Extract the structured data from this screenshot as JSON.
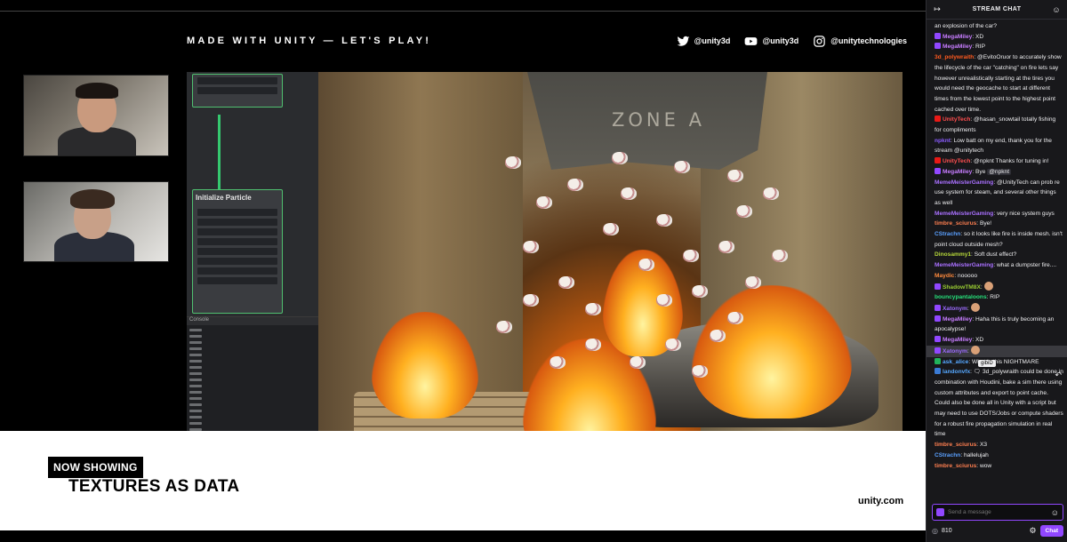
{
  "stream": {
    "header": "MADE WITH UNITY —  LET'S PLAY!",
    "socials": [
      {
        "icon": "twitter-icon",
        "handle": "@unity3d"
      },
      {
        "icon": "youtube-icon",
        "handle": "@unity3d"
      },
      {
        "icon": "instagram-icon",
        "handle": "@unitytechnologies"
      }
    ],
    "vfx_node_title": "Initialize Particle",
    "scene_sign": "ZONE A",
    "now_showing": "NOW SHOWING",
    "title": "TEXTURES AS DATA",
    "url": "unity.com"
  },
  "chat": {
    "header": "STREAM CHAT",
    "collapse_icon": "collapse-arrow-icon",
    "users_icon": "community-icon",
    "messages": [
      {
        "user": "",
        "color": "#efeff1",
        "text": "an explosion of the car?"
      },
      {
        "user": "MegaMiley",
        "color": "#c77dff",
        "badge": "#9147ff",
        "text": ": XD"
      },
      {
        "user": "MegaMiley",
        "color": "#c77dff",
        "badge": "#9147ff",
        "text": ": RIP"
      },
      {
        "user": "3d_polywraith",
        "color": "#ff5a1f",
        "text": ": @EvitoOruor to accurately show the lifecycle of the car \"catching\" on fire lets say however unrealistically starting at the tires you would need the geocache to start at different times from the lowest point to the highest point cached over time."
      },
      {
        "user": "UnityTech",
        "color": "#ff4f4f",
        "badge": "#e91916",
        "text": ": @hasan_snowtail totally fishing for compliments"
      },
      {
        "user": "npknt",
        "color": "#8a5cff",
        "text": ": Low batt on my end, thank you for the stream @unitytech"
      },
      {
        "user": "UnityTech",
        "color": "#ff4f4f",
        "badge": "#e91916",
        "text": ": @npknt  Thanks for tuning in!"
      },
      {
        "user": "MegaMiley",
        "color": "#c77dff",
        "badge": "#9147ff",
        "text": ": Bye ",
        "mention": "@npknt"
      },
      {
        "user": "MemeMeisterGaming",
        "color": "#a970ff",
        "text": ": @UnityTech can prob re use system for steam, and several other things as well"
      },
      {
        "user": "MemeMeisterGaming",
        "color": "#a970ff",
        "text": ": very nice system guys"
      },
      {
        "user": "timbre_sciurus",
        "color": "#ff7f50",
        "text": ": Bye!"
      },
      {
        "user": "CStrachn",
        "color": "#5aa0ff",
        "text": ": so it looks like fire is inside mesh. isn't point cloud outside mesh?"
      },
      {
        "user": "Dinosammy1",
        "color": "#b5d73a",
        "text": ": Soft dust effect?"
      },
      {
        "user": "MemeMeisterGaming",
        "color": "#a970ff",
        "text": ": what a dumpster fire...."
      },
      {
        "user": "Maydic",
        "color": "#ff8a3d",
        "text": ": nooooo"
      },
      {
        "user": "ShadowTM8X",
        "color": "#9acd32",
        "badge": "#9147ff",
        "text": ":"
      },
      {
        "user": "bouncypantaloons",
        "color": "#26e07a",
        "text": ": RIP"
      },
      {
        "user": "Xatonym",
        "color": "#9c6bff",
        "badge": "#9147ff",
        "text": ":"
      },
      {
        "user": "MegaMiley",
        "color": "#c77dff",
        "badge": "#9147ff",
        "text": ": Haha this is truly becoming an apocalypse!"
      },
      {
        "user": "MegaMiley",
        "color": "#c77dff",
        "badge": "#9147ff",
        "text": ": XD"
      },
      {
        "user": "Xatonym",
        "color": "#9c6bff",
        "badge": "#9147ff",
        "text": ":"
      },
      {
        "user": "ask_alice",
        "color": "#56a8ff",
        "badge": "#21b35a",
        "text": ": What is this NIGHTMARE"
      },
      {
        "user": "landonvfx",
        "color": "#56a8ff",
        "badge": "#3a7bd5",
        "text": ": 🗨 3d_polywraith  could be done in combination with Houdini, bake a sim there using custom attributes and export to point cache. Could also be done all in Unity with a script but may need to use DOTS/Jobs or compute shaders for a robust fire propagation simulation in real time"
      },
      {
        "user": "timbre_sciurus",
        "color": "#ff7f50",
        "text": ": X3"
      },
      {
        "user": "CStrachn",
        "color": "#5aa0ff",
        "text": ": hallelujah"
      },
      {
        "user": "timbre_sciurus",
        "color": "#ff7f50",
        "text": ": wow"
      }
    ],
    "tooltip": "gibiD",
    "input_placeholder": "Send a message",
    "points": "810",
    "send_label": "Chat"
  }
}
